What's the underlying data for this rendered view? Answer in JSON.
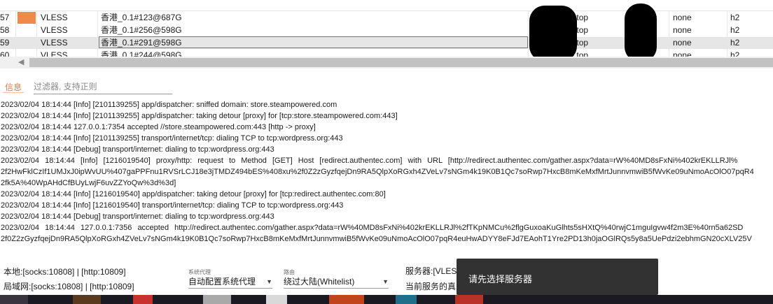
{
  "table": {
    "rows": [
      {
        "idx": "57",
        "type": "VLESS",
        "name": "香港_0.1#123@687G",
        "addr": "ode.top",
        "security": "none",
        "network": "h2",
        "color": "#f08a4b"
      },
      {
        "idx": "58",
        "type": "VLESS",
        "name": "香港_0.1#256@598G",
        "addr": "ode.top",
        "security": "none",
        "network": "h2"
      },
      {
        "idx": "59",
        "type": "VLESS",
        "name": "香港_0.1#291@598G",
        "addr": "ode.top",
        "security": "none",
        "network": "h2"
      },
      {
        "idx": "60",
        "type": "VLESS",
        "name": "香港_0.1#244@598G",
        "addr": "ode.top",
        "security": "none",
        "network": "h2"
      }
    ],
    "selected_index": 2
  },
  "log_panel": {
    "tab_label": "信息",
    "filter_placeholder": "过滤器, 支持正则",
    "lines": [
      "2023/02/04 18:14:44 [Info] [2101139255] app/dispatcher: sniffed domain: store.steampowered.com",
      "2023/02/04 18:14:44 [Info] [2101139255] app/dispatcher: taking detour [proxy] for [tcp:store.steampowered.com:443]",
      "2023/02/04 18:14:44 127.0.0.1:7354 accepted //store.steampowered.com:443 [http -> proxy]",
      "2023/02/04 18:14:44 [Info] [2101139255] transport/internet/tcp: dialing TCP to tcp:wordpress.org:443",
      "2023/02/04 18:14:44 [Debug] transport/internet: dialing to tcp:wordpress.org:443",
      "2023/02/04 18:14:44 [Info] [1216019540] proxy/http: request to Method [GET] Host [redirect.authentec.com] with URL [http://redirect.authentec.com/gather.aspx?data=rW%40MD8sFxNi%402krEKLLRJl%",
      "2f2HwFklCzIf1UMJxJ0ipWvUU%407gaPPFnu1RVSrLCJ18e3jTMDZ494bES%408xu%2f0Z2zGyzfqejDn9RA5QlpXoRGxh4ZVeLv7sNGm4k19K0B1Qc7soRwp7HxcB8mKeMxfMrtJunnvmwiB5fWvKe09uNmoAcOlO07pqR4",
      "2fk5A%40WpAHdCfBUyLwjF6uvZZYoQw%3d%3d]",
      "2023/02/04 18:14:44 [Info] [1216019540] app/dispatcher: taking detour [proxy] for [tcp:redirect.authentec.com:80]",
      "2023/02/04 18:14:44 [Info] [1216019540] transport/internet/tcp: dialing TCP to tcp:wordpress.org:443",
      "2023/02/04 18:14:44 [Debug] transport/internet: dialing to tcp:wordpress.org:443",
      "2023/02/04 18:14:44 127.0.0.1:7356 accepted http://redirect.authentec.com/gather.aspx?data=rW%40MD8sFxNi%402krEKLLRJl%2fTKpNMCu%2flgGuxoaKuGlhts5sHXtQ%40rwjC1mguIgvw4f2m3E%40rn5a62SD",
      "2f0Z2zGyzfqejDn9RA5QlpXoRGxh4ZVeLv7sNGm4k19K0B1Qc7soRwp7HxcB8mKeMxfMrtJunnvmwiB5fWvKe09uNmoAcOlO07pqR4euHwADYY8eFJd7EAohT1Yre2PD13h0jaOGlRQs5y8a5UePdzi2ebhmGN20cXLV25V"
    ]
  },
  "status": {
    "local": "本地:[socks:10808] | [http:10809]",
    "lan": "局域网:[socks:10808] | [http:10809]",
    "sysproxy_label": "系统代理",
    "sysproxy_value": "自动配置系统代理",
    "routing_label": "路由",
    "routing_value": "绕过大陆(Whitelist)",
    "server_text": "服务器:[VLESS",
    "current_text": "当前服务的真"
  },
  "toast": {
    "message": "请先选择服务器"
  },
  "colors": {
    "accent": "#e07a4e",
    "toast_bg": "#323232"
  }
}
